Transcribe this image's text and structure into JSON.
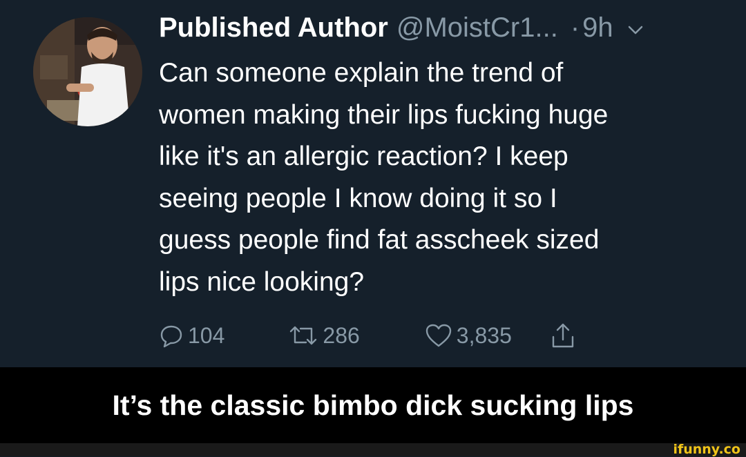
{
  "tweet": {
    "display_name": "Published Author",
    "handle": "@MoistCr1...",
    "separator": "·",
    "time": "9h",
    "text": "Can someone explain the trend of\nwomen making their lips fucking huge\nlike it's an allergic reaction? I keep\nseeing people I know doing it so I\nguess people find fat asscheek sized\nlips nice looking?",
    "actions": {
      "replies": "104",
      "retweets": "286",
      "likes": "3,835"
    }
  },
  "caption": "It’s the classic bimbo dick sucking lips",
  "watermark": "ifunny.co",
  "colors": {
    "background": "#15202b",
    "primary_text": "#ffffff",
    "secondary_text": "#8899a6",
    "watermark": "#f0c419"
  },
  "icons": [
    "chevron-down-icon",
    "reply-icon",
    "retweet-icon",
    "like-icon",
    "share-icon"
  ]
}
